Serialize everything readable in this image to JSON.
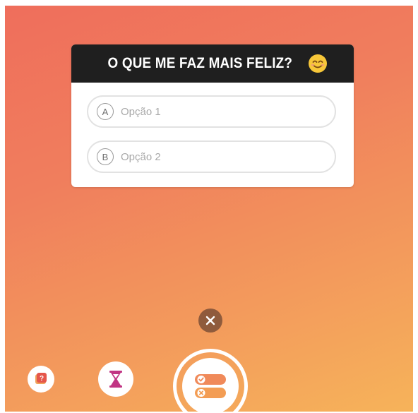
{
  "quiz": {
    "title": "O QUE ME FAZ MAIS FELIZ?",
    "title_icon": "smiling-face-emoji",
    "options": [
      {
        "letter": "A",
        "placeholder": "Opção 1"
      },
      {
        "letter": "B",
        "placeholder": "Opção 2"
      }
    ]
  },
  "controls": {
    "close_icon": "close-icon",
    "tools": [
      {
        "icon": "question-sticker-icon"
      },
      {
        "icon": "hourglass-icon"
      },
      {
        "icon": "quiz-sticker-icon"
      }
    ]
  },
  "colors": {
    "background_top": "#ef6e5c",
    "background_bottom": "#f6b35a",
    "header": "#1f1f1f",
    "hourglass": "#c13584"
  }
}
